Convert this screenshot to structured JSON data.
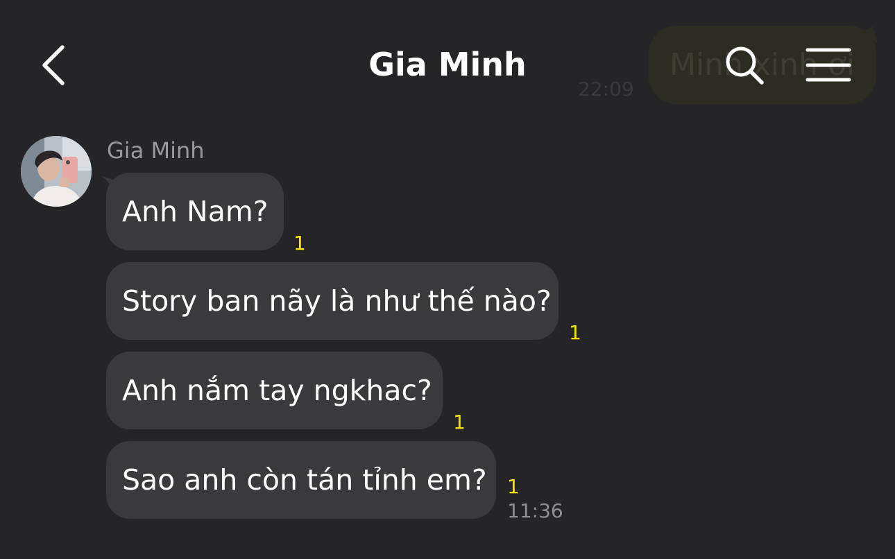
{
  "header": {
    "title": "Gia Minh",
    "back_icon": "chevron-left-icon",
    "search_icon": "search-icon",
    "menu_icon": "hamburger-menu-icon"
  },
  "background_message": {
    "text": "Minh xinh ơi",
    "time": "22:09"
  },
  "conversation": {
    "sender_name": "Gia Minh",
    "messages": [
      {
        "text": "Anh Nam?",
        "unread": "1"
      },
      {
        "text": "Story ban nãy là như thế nào?",
        "unread": "1"
      },
      {
        "text": "Anh nắm tay ngkhac?",
        "unread": "1"
      },
      {
        "text": "Sao anh còn tán tỉnh em?",
        "unread": "1",
        "time": "11:36"
      }
    ]
  },
  "colors": {
    "background": "#252527",
    "bubble": "#3a3a3c",
    "unread_count": "#f7e600",
    "secondary_text": "#8e8e93"
  }
}
